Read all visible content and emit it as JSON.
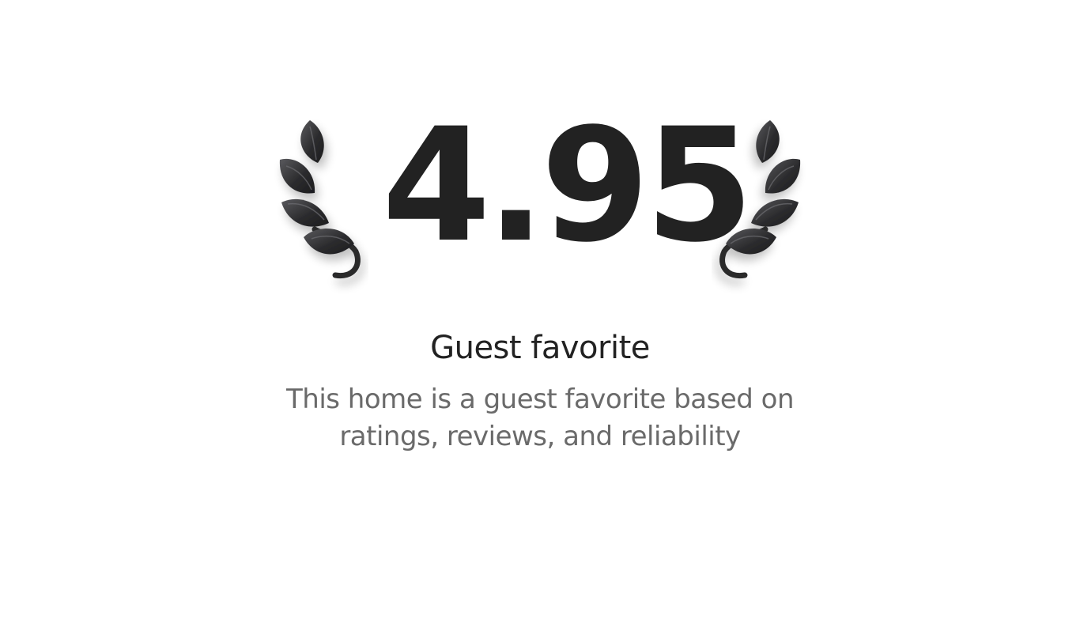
{
  "rating": {
    "value": "4.95"
  },
  "badge": {
    "title": "Guest favorite",
    "description": "This home is a guest favorite based on ratings, reviews, and reliability"
  },
  "icons": {
    "left": "laurel-left-icon",
    "right": "laurel-right-icon"
  },
  "colors": {
    "text_primary": "#222222",
    "text_secondary": "#6a6a6a",
    "laurel": "#3a3a3c",
    "background": "#ffffff"
  }
}
